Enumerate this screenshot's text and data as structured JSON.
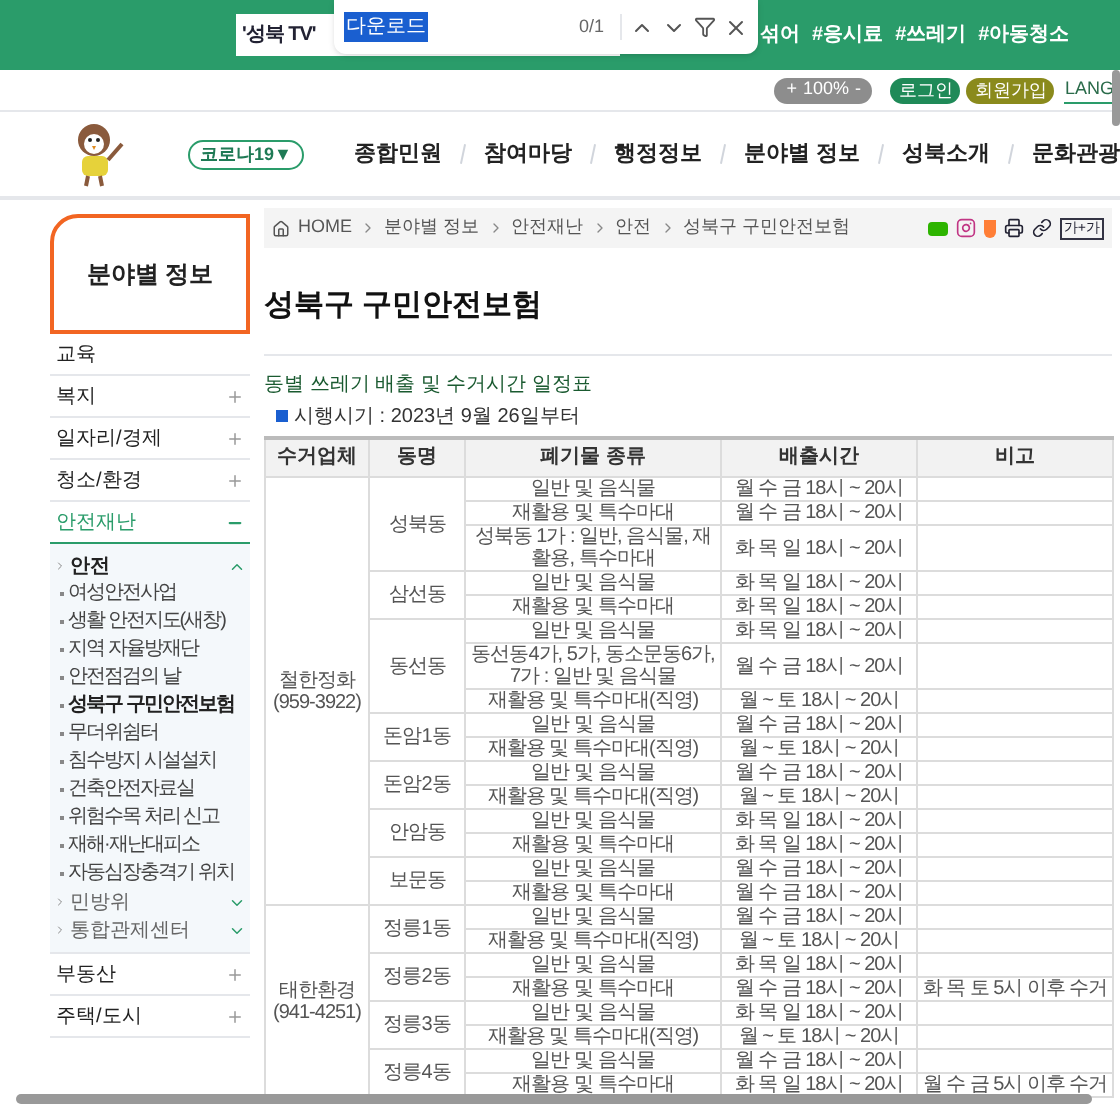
{
  "find_bar": {
    "query": "다운로드",
    "count": "0/1"
  },
  "header": {
    "search_value": "'성북 TV'",
    "hashtags": [
      "섞어",
      "#응시료",
      "#쓰레기",
      "#아동청소"
    ],
    "zoom_in": "+",
    "zoom_value": "100%",
    "zoom_out": "-",
    "login": "로그인",
    "signup": "회원가입",
    "language": "LANG"
  },
  "nav": {
    "corona": "코로나19▼",
    "items": [
      "종합민원",
      "참여마당",
      "행정정보",
      "분야별 정보",
      "성북소개",
      "문화관광"
    ]
  },
  "sidebar": {
    "title": "분야별 정보",
    "items": [
      {
        "label": "교육",
        "kind": "link"
      },
      {
        "label": "복지",
        "kind": "menu",
        "expanded": false
      },
      {
        "label": "일자리/경제",
        "kind": "menu",
        "expanded": false
      },
      {
        "label": "청소/환경",
        "kind": "menu",
        "expanded": false
      },
      {
        "label": "안전재난",
        "kind": "menu",
        "expanded": true,
        "children": [
          {
            "label": "안전",
            "expanded": true,
            "children": [
              {
                "label": "여성안전사업",
                "selected": false
              },
              {
                "label": "생활 안전지도(새창)",
                "selected": false
              },
              {
                "label": "지역 자율방재단",
                "selected": false
              },
              {
                "label": "안전점검의 날",
                "selected": false
              },
              {
                "label": "성북구 구민안전보험",
                "selected": true
              },
              {
                "label": "무더위쉼터",
                "selected": false
              },
              {
                "label": "침수방지 시설설치",
                "selected": false
              },
              {
                "label": "건축안전자료실",
                "selected": false
              },
              {
                "label": "위험수목 처리 신고",
                "selected": false
              },
              {
                "label": "재해·재난대피소",
                "selected": false
              },
              {
                "label": "자동심장충격기 위치",
                "selected": false
              }
            ]
          },
          {
            "label": "민방위",
            "expanded": false
          },
          {
            "label": "통합관제센터",
            "expanded": false
          }
        ]
      },
      {
        "label": "부동산",
        "kind": "menu",
        "expanded": false
      },
      {
        "label": "주택/도시",
        "kind": "menu",
        "expanded": false
      }
    ]
  },
  "breadcrumb": [
    "HOME",
    "분야별 정보",
    "안전재난",
    "안전",
    "성북구 구민안전보험"
  ],
  "font_size_button": "가+가",
  "page_title": "성북구 구민안전보험",
  "section_title": "동별 쓰레기 배출 및 수거시간 일정표",
  "effective_date": "시행시기 : 2023년 9월 26일부터",
  "table": {
    "columns": [
      "수거업체",
      "동명",
      "폐기물 종류",
      "배출시간",
      "비고"
    ],
    "groups": [
      {
        "company": "철한정화",
        "phone": "(959-3922)",
        "dongs": [
          {
            "name": "성북동",
            "rows": [
              [
                "일반 및 음식물",
                "월 수 금 18시 ~ 20시",
                ""
              ],
              [
                "재활용 및 특수마대",
                "월 수 금 18시 ~ 20시",
                ""
              ],
              [
                "성북동 1가 : 일반, 음식물, 재활용, 특수마대",
                "화 목 일 18시 ~ 20시",
                ""
              ]
            ]
          },
          {
            "name": "삼선동",
            "rows": [
              [
                "일반 및 음식물",
                "화 목 일 18시 ~ 20시",
                ""
              ],
              [
                "재활용 및 특수마대",
                "화 목 일 18시 ~ 20시",
                ""
              ]
            ]
          },
          {
            "name": "동선동",
            "rows": [
              [
                "일반 및 음식물",
                "화 목 일 18시 ~ 20시",
                ""
              ],
              [
                "동선동4가, 5가, 동소문동6가, 7가 : 일반 및 음식물",
                "월 수 금 18시 ~ 20시",
                ""
              ],
              [
                "재활용 및 특수마대(직영)",
                "월 ~ 토 18시 ~ 20시",
                ""
              ]
            ]
          },
          {
            "name": "돈암1동",
            "rows": [
              [
                "일반 및 음식물",
                "월 수 금 18시 ~ 20시",
                ""
              ],
              [
                "재활용 및 특수마대(직영)",
                "월 ~ 토 18시 ~ 20시",
                ""
              ]
            ]
          },
          {
            "name": "돈암2동",
            "rows": [
              [
                "일반 및 음식물",
                "월 수 금 18시 ~ 20시",
                ""
              ],
              [
                "재활용 및 특수마대(직영)",
                "월 ~ 토 18시 ~ 20시",
                ""
              ]
            ]
          },
          {
            "name": "안암동",
            "rows": [
              [
                "일반 및 음식물",
                "화 목 일 18시 ~ 20시",
                ""
              ],
              [
                "재활용 및 특수마대",
                "화 목 일 18시 ~ 20시",
                ""
              ]
            ]
          },
          {
            "name": "보문동",
            "rows": [
              [
                "일반 및 음식물",
                "월 수 금 18시 ~ 20시",
                ""
              ],
              [
                "재활용 및 특수마대",
                "월 수 금 18시 ~ 20시",
                ""
              ]
            ]
          }
        ]
      },
      {
        "company": "태한환경",
        "phone": "(941-4251)",
        "dongs": [
          {
            "name": "정릉1동",
            "rows": [
              [
                "일반 및 음식물",
                "월 수 금 18시 ~ 20시",
                ""
              ],
              [
                "재활용 및 특수마대(직영)",
                "월 ~ 토 18시 ~ 20시",
                ""
              ]
            ]
          },
          {
            "name": "정릉2동",
            "rows": [
              [
                "일반 및 음식물",
                "화 목 일 18시 ~ 20시",
                ""
              ],
              [
                "재활용 및 특수마대",
                "월 수 금 18시 ~ 20시",
                "화 목 토 5시 이후 수거"
              ]
            ]
          },
          {
            "name": "정릉3동",
            "rows": [
              [
                "일반 및 음식물",
                "화 목 일 18시 ~ 20시",
                ""
              ],
              [
                "재활용 및 특수마대(직영)",
                "월 ~ 토 18시 ~ 20시",
                ""
              ]
            ]
          },
          {
            "name": "정릉4동",
            "rows": [
              [
                "일반 및 음식물",
                "월 수 금 18시 ~ 20시",
                ""
              ],
              [
                "재활용 및 특수마대",
                "화 목 일 18시 ~ 20시",
                "월 수 금 5시 이후 수거"
              ]
            ]
          }
        ]
      }
    ]
  }
}
